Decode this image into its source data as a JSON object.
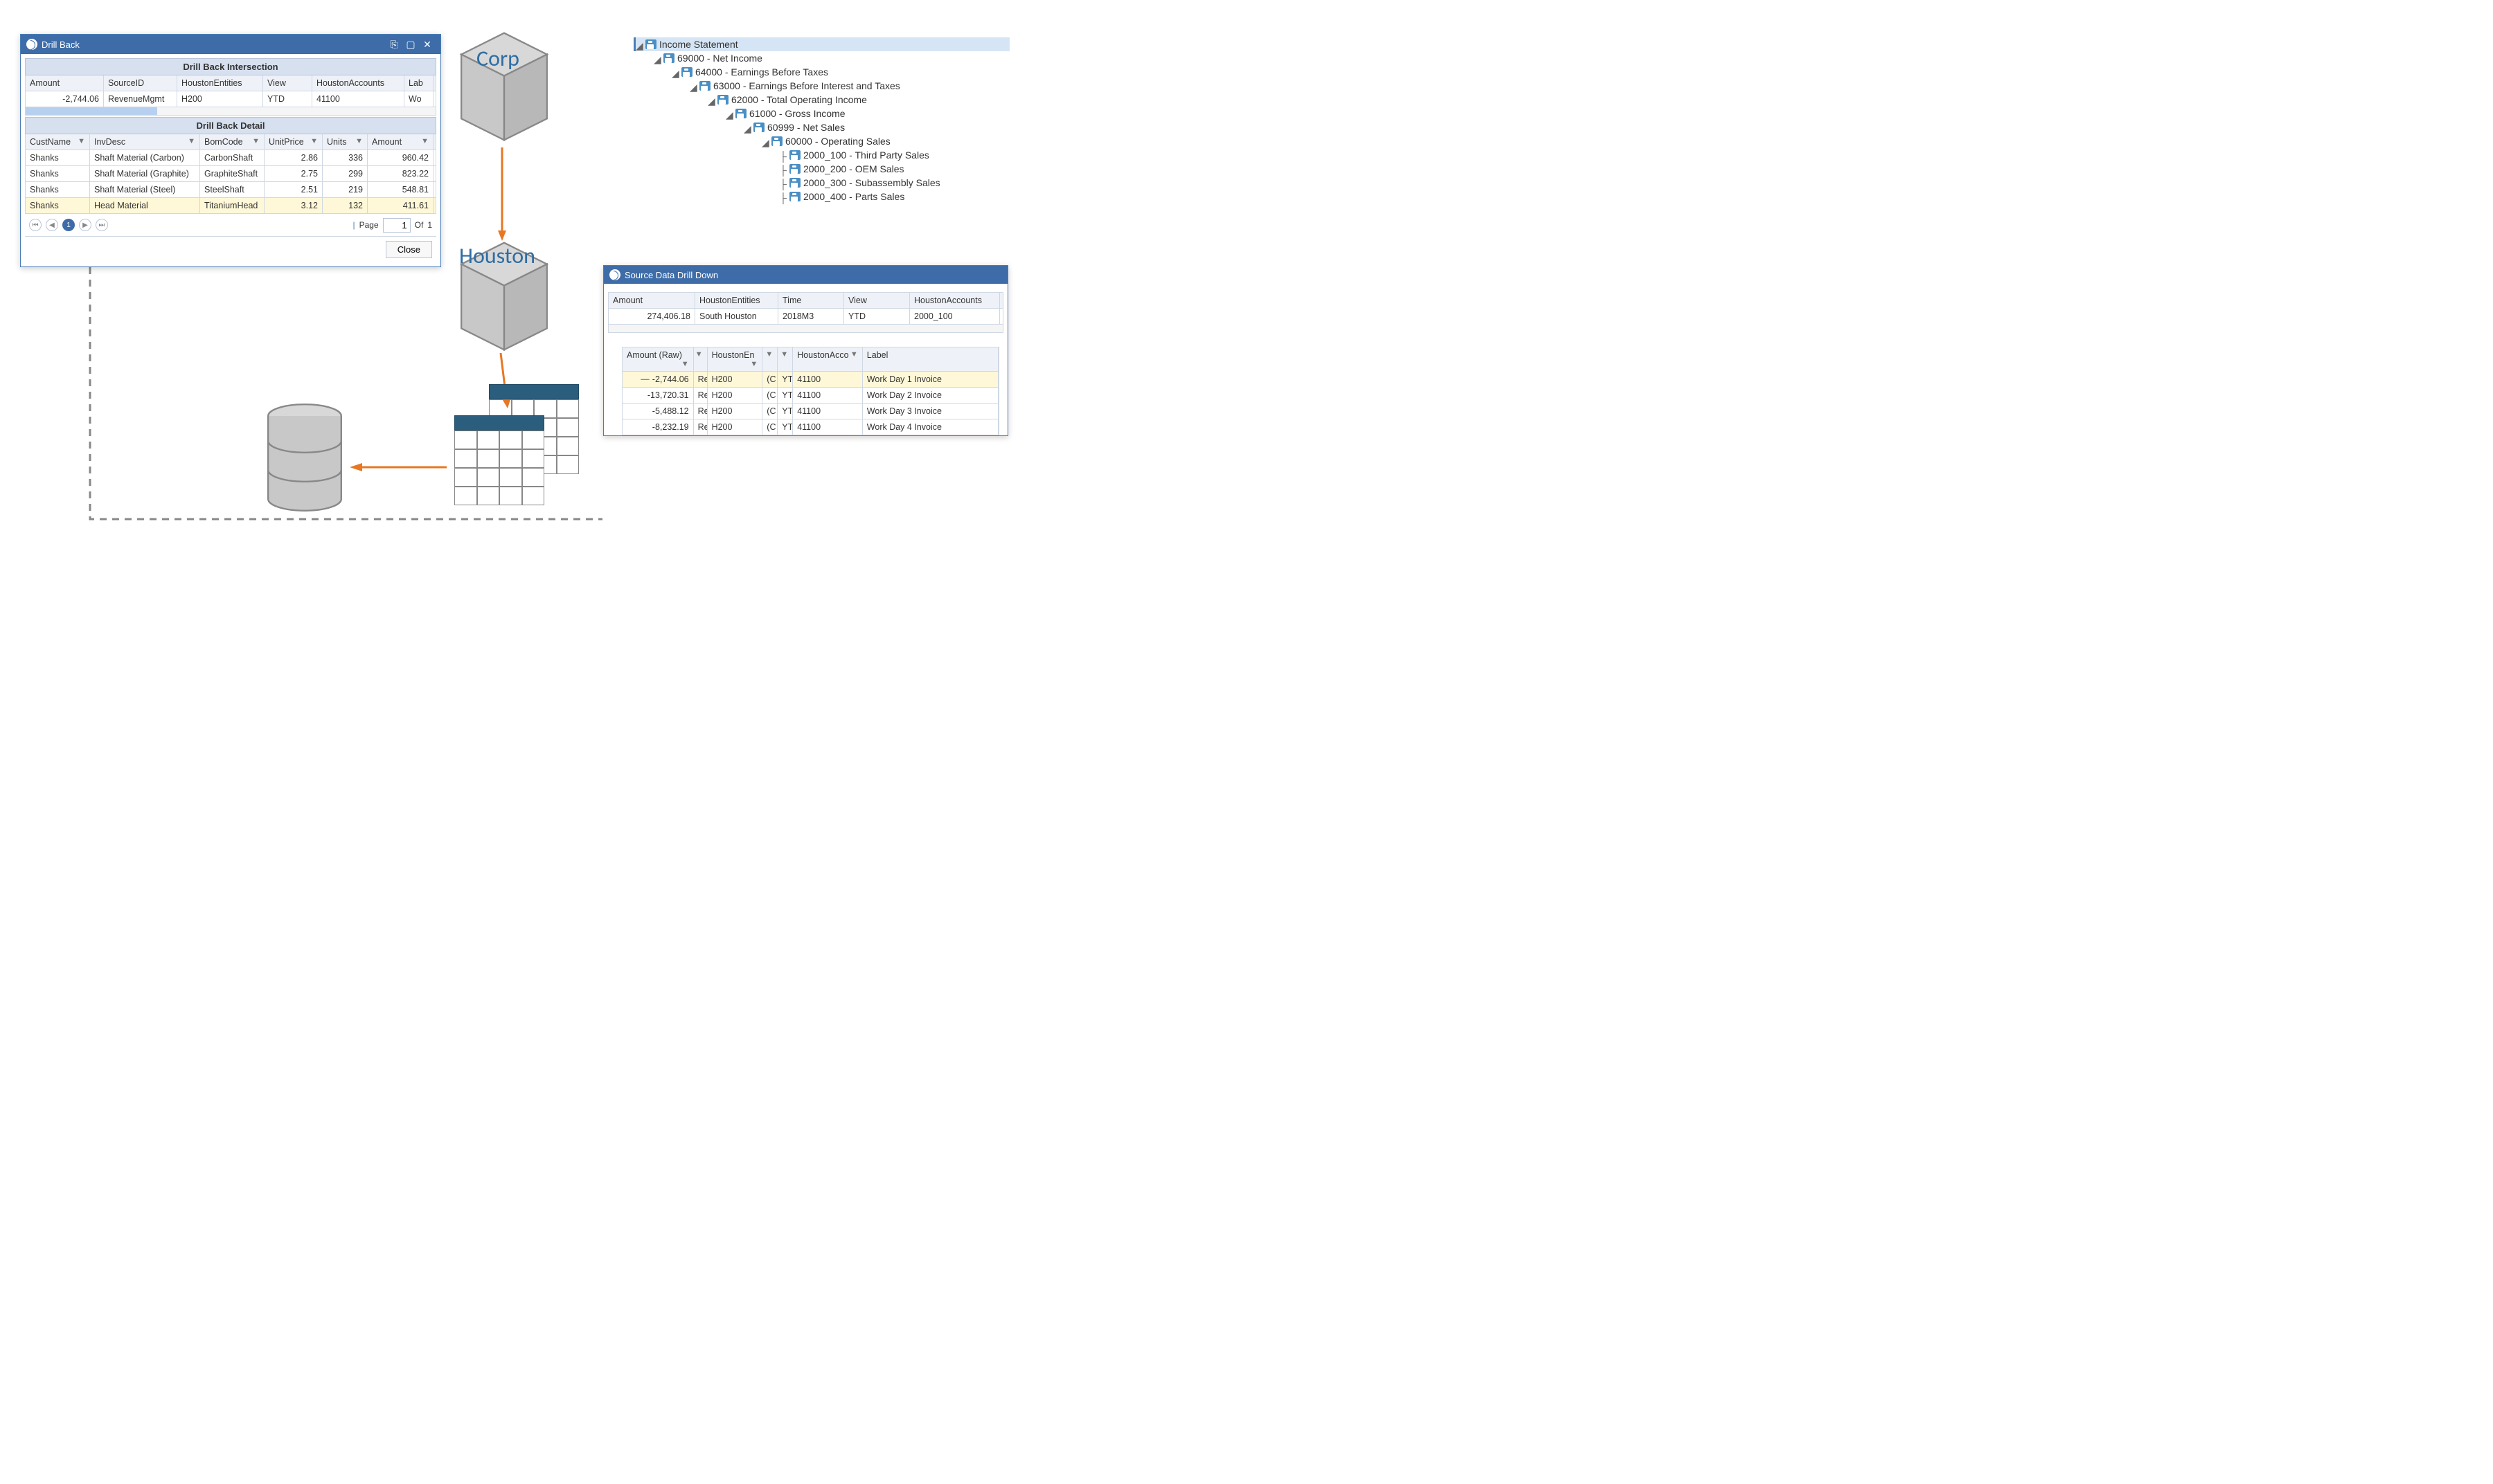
{
  "drill_back": {
    "title": "Drill Back",
    "intersection_header": "Drill Back Intersection",
    "intersection_columns": [
      "Amount",
      "SourceID",
      "HoustonEntities",
      "View",
      "HoustonAccounts",
      "Lab"
    ],
    "intersection_row": {
      "amount": "-2,744.06",
      "sourceid": "RevenueMgmt",
      "entities": "H200",
      "view": "YTD",
      "accounts": "41100",
      "label": "Wo"
    },
    "detail_header": "Drill Back Detail",
    "detail_columns": [
      "CustName",
      "InvDesc",
      "BomCode",
      "UnitPrice",
      "Units",
      "Amount"
    ],
    "detail_rows": [
      {
        "cust": "Shanks",
        "inv": "Shaft Material (Carbon)",
        "bom": "CarbonShaft",
        "price": "2.86",
        "units": "336",
        "amount": "960.42"
      },
      {
        "cust": "Shanks",
        "inv": "Shaft Material (Graphite)",
        "bom": "GraphiteShaft",
        "price": "2.75",
        "units": "299",
        "amount": "823.22"
      },
      {
        "cust": "Shanks",
        "inv": "Shaft Material (Steel)",
        "bom": "SteelShaft",
        "price": "2.51",
        "units": "219",
        "amount": "548.81"
      },
      {
        "cust": "Shanks",
        "inv": "Head Material",
        "bom": "TitaniumHead",
        "price": "3.12",
        "units": "132",
        "amount": "411.61"
      }
    ],
    "page_label": "Page",
    "page_current": "1",
    "page_of": "Of",
    "page_total": "1",
    "close": "Close"
  },
  "cubes": {
    "corp": "Corp",
    "houston": "Houston"
  },
  "tree": {
    "items": [
      {
        "indent": 0,
        "label": "Income Statement",
        "highlight": true
      },
      {
        "indent": 1,
        "label": "69000 - Net Income"
      },
      {
        "indent": 2,
        "label": "64000 - Earnings Before Taxes"
      },
      {
        "indent": 3,
        "label": "63000 - Earnings Before Interest and Taxes"
      },
      {
        "indent": 4,
        "label": "62000 - Total Operating Income"
      },
      {
        "indent": 5,
        "label": "61000 - Gross Income"
      },
      {
        "indent": 6,
        "label": "60999 - Net Sales"
      },
      {
        "indent": 7,
        "label": "60000 - Operating Sales"
      },
      {
        "indent": 8,
        "label": "2000_100 - Third Party Sales",
        "leaf": true
      },
      {
        "indent": 8,
        "label": "2000_200 - OEM Sales",
        "leaf": true
      },
      {
        "indent": 8,
        "label": "2000_300 - Subassembly Sales",
        "leaf": true
      },
      {
        "indent": 8,
        "label": "2000_400 - Parts Sales",
        "leaf": true
      }
    ]
  },
  "drill_down": {
    "title": "Source Data Drill Down",
    "top_columns": [
      "Amount",
      "HoustonEntities",
      "Time",
      "View",
      "HoustonAccounts"
    ],
    "top_row": {
      "amount": "274,406.18",
      "entities": "South Houston",
      "time": "2018M3",
      "view": "YTD",
      "accounts": "2000_100"
    },
    "nested_columns": [
      "Amount (Raw)",
      "HoustonEn",
      "HoustonAcco",
      "Label"
    ],
    "mini_cols": {
      "c1": "Re",
      "c2": "(C",
      "c3": "YT"
    },
    "nested_rows": [
      {
        "amount": "-2,744.06",
        "ent": "H200",
        "acc": "41100",
        "label": "Work Day 1 Invoice",
        "highlight": true,
        "expanded": true
      },
      {
        "amount": "-13,720.31",
        "ent": "H200",
        "acc": "41100",
        "label": "Work Day 2 Invoice"
      },
      {
        "amount": "-5,488.12",
        "ent": "H200",
        "acc": "41100",
        "label": "Work Day 3 Invoice"
      },
      {
        "amount": "-8,232.19",
        "ent": "H200",
        "acc": "41100",
        "label": "Work Day 4 Invoice"
      }
    ]
  }
}
